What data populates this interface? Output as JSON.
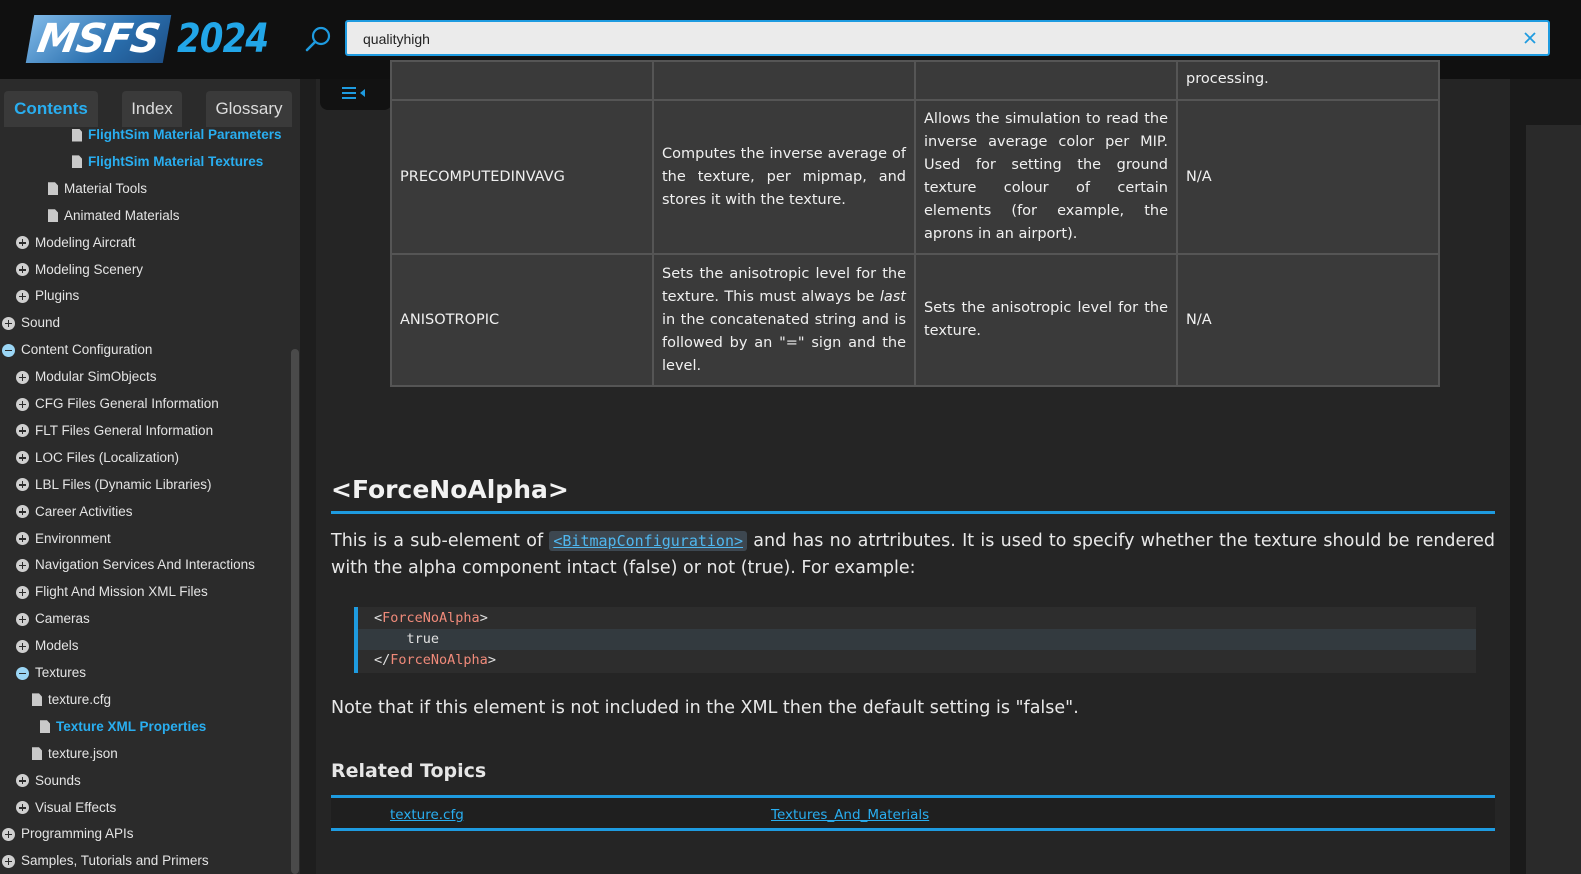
{
  "header": {
    "logo_text": "MSFS",
    "logo_year": "2024",
    "search_value": "qualityhigh"
  },
  "sidebar": {
    "tabs": [
      "Contents",
      "Index",
      "Glossary"
    ],
    "items": [
      {
        "label": "FlightSim Material Parameters",
        "icon": "page-icon",
        "link": true
      },
      {
        "label": "FlightSim Material Textures",
        "icon": "page-icon",
        "link": true
      },
      {
        "label": "Material Tools",
        "icon": "page-icon",
        "link": false
      },
      {
        "label": "Animated Materials",
        "icon": "page-icon",
        "link": false
      },
      {
        "label": "Modeling Aircraft",
        "icon": "plus-icon",
        "link": false
      },
      {
        "label": "Modeling Scenery",
        "icon": "plus-icon",
        "link": false
      },
      {
        "label": "Plugins",
        "icon": "plus-icon",
        "link": false
      },
      {
        "label": "Sound",
        "icon": "plus-icon",
        "link": false
      },
      {
        "label": "Content Configuration",
        "icon": "minus-icon",
        "link": false
      },
      {
        "label": "Modular SimObjects",
        "icon": "plus-icon",
        "link": false
      },
      {
        "label": "CFG Files General Information",
        "icon": "plus-icon",
        "link": false
      },
      {
        "label": "FLT Files General Information",
        "icon": "plus-icon",
        "link": false
      },
      {
        "label": "LOC Files (Localization)",
        "icon": "plus-icon",
        "link": false
      },
      {
        "label": "LBL Files (Dynamic Libraries)",
        "icon": "plus-icon",
        "link": false
      },
      {
        "label": "Career Activities",
        "icon": "plus-icon",
        "link": false
      },
      {
        "label": "Environment",
        "icon": "plus-icon",
        "link": false
      },
      {
        "label": "Navigation Services And Interactions",
        "icon": "plus-icon",
        "link": false
      },
      {
        "label": "Flight And Mission XML Files",
        "icon": "plus-icon",
        "link": false
      },
      {
        "label": "Cameras",
        "icon": "plus-icon",
        "link": false
      },
      {
        "label": "Models",
        "icon": "plus-icon",
        "link": false
      },
      {
        "label": "Textures",
        "icon": "minus-icon",
        "link": false
      },
      {
        "label": "texture.cfg",
        "icon": "page-icon",
        "link": false
      },
      {
        "label": "Texture XML Properties",
        "icon": "page-icon",
        "link": true
      },
      {
        "label": "texture.json",
        "icon": "page-icon",
        "link": false
      },
      {
        "label": "Sounds",
        "icon": "plus-icon",
        "link": false
      },
      {
        "label": "Visual Effects",
        "icon": "plus-icon",
        "link": false
      },
      {
        "label": "Programming APIs",
        "icon": "plus-icon",
        "link": false
      },
      {
        "label": "Samples, Tutorials and Primers",
        "icon": "plus-icon",
        "link": false
      }
    ]
  },
  "table": {
    "top_row": [
      "",
      "",
      "",
      "processing."
    ],
    "rows": [
      [
        "PRECOMPUTEDINVAVG",
        "Computes the inverse average of the texture, per mipmap, and stores it with the texture.",
        "Allows the simulation to read the inverse average color per MIP. Used for setting the ground texture colour of certain elements (for example, the aprons in an airport).",
        "N/A"
      ],
      [
        "ANISOTROPIC",
        null,
        "Sets the anisotropic level for the texture.",
        "N/A"
      ]
    ],
    "aniso_desc_before": "Sets the anisotropic level for the texture. This must always be ",
    "aniso_desc_em": "last",
    "aniso_desc_after": " in the concatenated string and is followed by an \"=\" sign and the level."
  },
  "section": {
    "title": "<ForceNoAlpha>",
    "intro_before": "This is a sub-element of ",
    "intro_link": "<BitmapConfiguration>",
    "intro_after": " and has no atrtributes. It is used to specify whether the texture should be rendered with the alpha component intact (false) or not (true). For example:",
    "code_open_lt": "<",
    "code_tag": "ForceNoAlpha",
    "code_gt": ">",
    "code_value": "    true",
    "code_close_lt": "</",
    "note": "Note that if this element is not included in the XML then the default setting is \"false\"."
  },
  "related": {
    "title": "Related Topics",
    "links": [
      "texture.cfg",
      "Textures_And_Materials"
    ]
  }
}
